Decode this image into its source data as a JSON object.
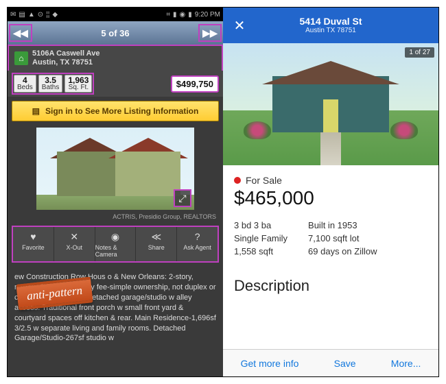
{
  "left": {
    "statusbar": {
      "time": "9:20 PM"
    },
    "pager": {
      "position": "5 of 36"
    },
    "address": {
      "line1": "5106A Caswell Ave",
      "line2": "Austin, TX 78751"
    },
    "stats": {
      "beds_val": "4",
      "beds_lbl": "Beds",
      "baths_val": "3.5",
      "baths_lbl": "Baths",
      "sqft_val": "1,963",
      "sqft_lbl": "Sq. Ft."
    },
    "price": "$499,750",
    "signin_cta": "Sign in to See More Listing Information",
    "credit": "ACTRIS, Presidio Group, REALTORS",
    "actions": {
      "favorite": "Favorite",
      "xout": "X-Out",
      "notes": "Notes & Camera",
      "share": "Share",
      "ask": "Ask Agent"
    },
    "sticker": "anti-pattern",
    "description": "ew Construction Row Hous o & New Orleans: 2-story, narrow & deep). Sing ily fee-simple ownership, not duplex or condo. Main house w detached garage/studio w alley access. Traditional front porch w small front yard & courtyard spaces off kitchen & rear. Main Residence-1,696sf 3/2.5 w separate living and family rooms. Detached Garage/Studio-267sf studio w"
  },
  "right": {
    "title": "5414 Duval St",
    "subtitle": "Austin TX 78751",
    "photo_counter": "1 of 27",
    "status": "For Sale",
    "price": "$465,000",
    "facts": {
      "bedbath": "3 bd 3 ba",
      "type": "Single Family",
      "sqft": "1,558 sqft",
      "built": "Built in 1953",
      "lot": "7,100 sqft lot",
      "days": "69 days on Zillow"
    },
    "section_heading": "Description",
    "tabs": {
      "info": "Get more info",
      "save": "Save",
      "more": "More..."
    }
  }
}
